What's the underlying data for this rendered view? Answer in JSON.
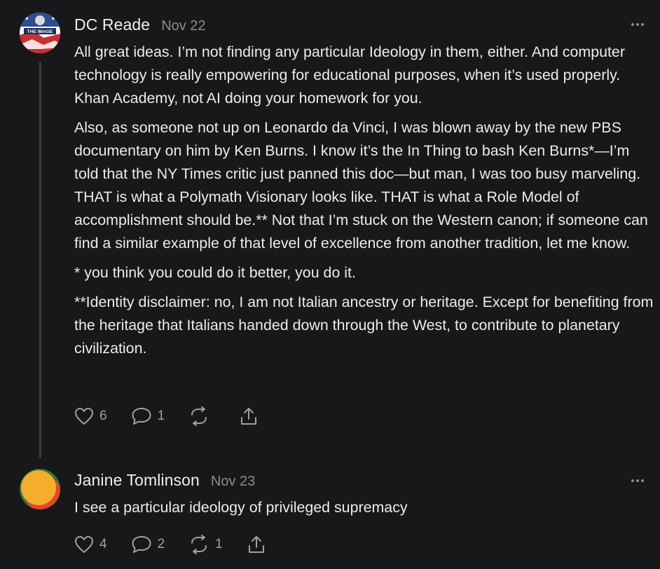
{
  "comments": [
    {
      "author": "DC Reade",
      "date": "Nov 22",
      "avatar_text": "THE IMAGE",
      "paragraphs": [
        "All great ideas. I’m not finding any particular Ideology in them, either. And computer technology is really empowering for educational purposes, when it’s used properly. Khan Academy, not AI doing your homework for you.",
        "Also, as someone not up on Leonardo da Vinci, I was blown away by the new PBS documentary on him by Ken Burns. I know it’s the In Thing to bash Ken Burns*—I’m told that the NY Times critic just panned this doc—but man, I was too busy marveling. THAT is what a Polymath Visionary looks like. THAT is what a Role Model of accomplishment should be.** Not that I’m stuck on the Western canon; if someone can find a similar example of that level of excellence from another tradition, let me know.",
        "* you think you could do it better, you do it.",
        "**Identity disclaimer: no, I am not Italian ancestry or heritage. Except for benefiting from the heritage that Italians handed down through the West, to contribute to planetary civilization."
      ],
      "likes": "6",
      "replies": "1",
      "restacks": ""
    },
    {
      "author": "Janine Tomlinson",
      "date": "Nov 23",
      "paragraphs": [
        "I see a particular ideology of privileged supremacy"
      ],
      "likes": "4",
      "replies": "2",
      "restacks": "1"
    }
  ],
  "icons": {
    "like": "heart-icon",
    "reply": "comment-icon",
    "restack": "restack-icon",
    "share": "share-icon",
    "more": "more-dots-icon"
  },
  "colors": {
    "background": "#18181a",
    "text": "#ececee",
    "muted": "#8c8c90",
    "icon": "#a0a0a4",
    "thread_line": "#3a3a3d"
  }
}
